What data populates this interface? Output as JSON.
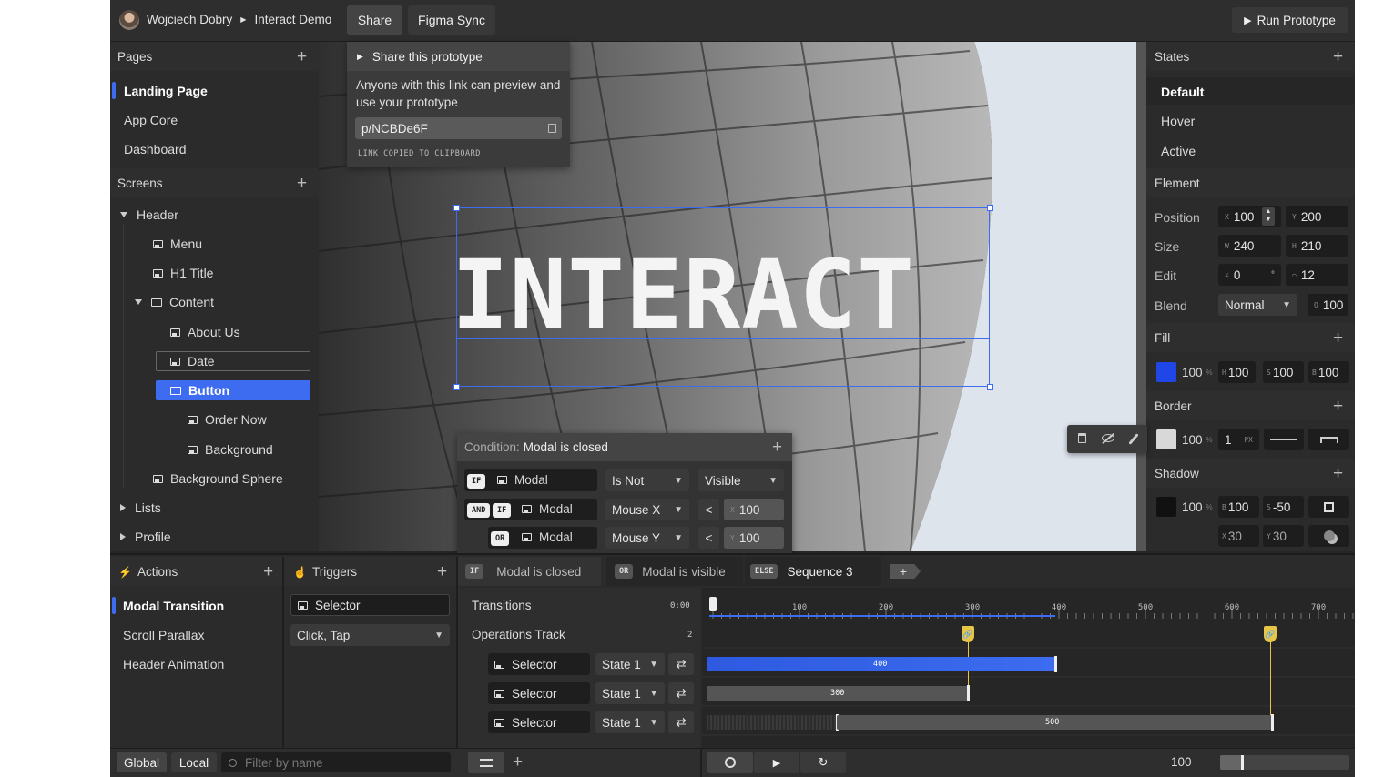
{
  "topbar": {
    "user_name": "Wojciech Dobry",
    "project_name": "Interact Demo",
    "share_label": "Share",
    "figma_sync_label": "Figma Sync",
    "run_prototype_label": "Run Prototype"
  },
  "share_popover": {
    "title": "Share this prototype",
    "description": "Anyone with this link can preview and use your prototype",
    "link": "p/NCBDe6F",
    "status": "LINK COPIED TO CLIPBOARD"
  },
  "pages_panel": {
    "title": "Pages",
    "items": [
      "Landing Page",
      "App Core",
      "Dashboard"
    ],
    "selected": "Landing Page"
  },
  "screens_panel": {
    "title": "Screens",
    "tree": {
      "header": "Header",
      "menu": "Menu",
      "h1_title": "H1 Title",
      "content": "Content",
      "about_us": "About Us",
      "date": "Date",
      "button": "Button",
      "order_now": "Order Now",
      "background": "Background",
      "background_sphere": "Background Sphere",
      "lists": "Lists",
      "profile": "Profile"
    }
  },
  "canvas": {
    "headline": "INTERACT"
  },
  "condition_popup": {
    "label": "Condition:",
    "value": "Modal is closed",
    "rows": [
      {
        "pill": "IF",
        "element": "Modal",
        "property": "Is Not",
        "value": "Visible"
      },
      {
        "pill_and": "AND",
        "pill": "IF",
        "element": "Modal",
        "property": "Mouse X",
        "op": "<",
        "axis": "X",
        "value": "100"
      },
      {
        "pill": "OR",
        "element": "Modal",
        "property": "Mouse Y",
        "op": "<",
        "axis": "Y",
        "value": "100"
      }
    ]
  },
  "states_panel": {
    "title": "States",
    "items": [
      "Default",
      "Hover",
      "Active"
    ],
    "selected": "Default"
  },
  "element_panel": {
    "title": "Element",
    "position_label": "Position",
    "x": "100",
    "y": "200",
    "size_label": "Size",
    "w": "240",
    "h": "210",
    "edit_label": "Edit",
    "rotation": "0",
    "radius": "12",
    "blend_label": "Blend",
    "blend_mode": "Normal",
    "opacity": "100"
  },
  "fill_panel": {
    "title": "Fill",
    "color": "#2146e8",
    "alpha": "100",
    "h": "100",
    "s": "100",
    "b": "100"
  },
  "border_panel": {
    "title": "Border",
    "color": "#d8d8d8",
    "alpha": "100",
    "width": "1",
    "unit": "PX"
  },
  "shadow_panel": {
    "title": "Shadow",
    "color": "#111111",
    "alpha": "100",
    "blur": "100",
    "spread": "-50",
    "x": "30",
    "y": "30"
  },
  "actions_panel": {
    "title": "Actions",
    "items": [
      "Modal Transition",
      "Scroll Parallax",
      "Header Animation"
    ],
    "selected": "Modal Transition"
  },
  "triggers_panel": {
    "title": "Triggers",
    "selector": "Selector",
    "event": "Click, Tap"
  },
  "sequence_tabs": [
    {
      "pill": "IF",
      "label": "Modal is closed"
    },
    {
      "pill": "OR",
      "label": "Modal is visible"
    },
    {
      "pill": "ELSE",
      "label": "Sequence 3"
    }
  ],
  "timeline": {
    "transitions_label": "Transitions",
    "transitions_time": "0:00",
    "operations_label": "Operations Track",
    "operations_count": "2",
    "ruler_ticks": [
      "100",
      "200",
      "300",
      "400",
      "500",
      "600",
      "700"
    ],
    "tracks": [
      {
        "element": "Selector",
        "state": "State 1",
        "duration": "400"
      },
      {
        "element": "Selector",
        "state": "State 1",
        "duration": "300"
      },
      {
        "element": "Selector",
        "state": "State 1",
        "duration": "500"
      }
    ],
    "zoom": "100"
  },
  "bottom_bar": {
    "global_label": "Global",
    "local_label": "Local",
    "filter_placeholder": "Filter by name"
  },
  "colors": {
    "accent": "#3d6cf0",
    "panel": "#2b2b2b",
    "background": "#262626",
    "marker": "#e8c547"
  }
}
